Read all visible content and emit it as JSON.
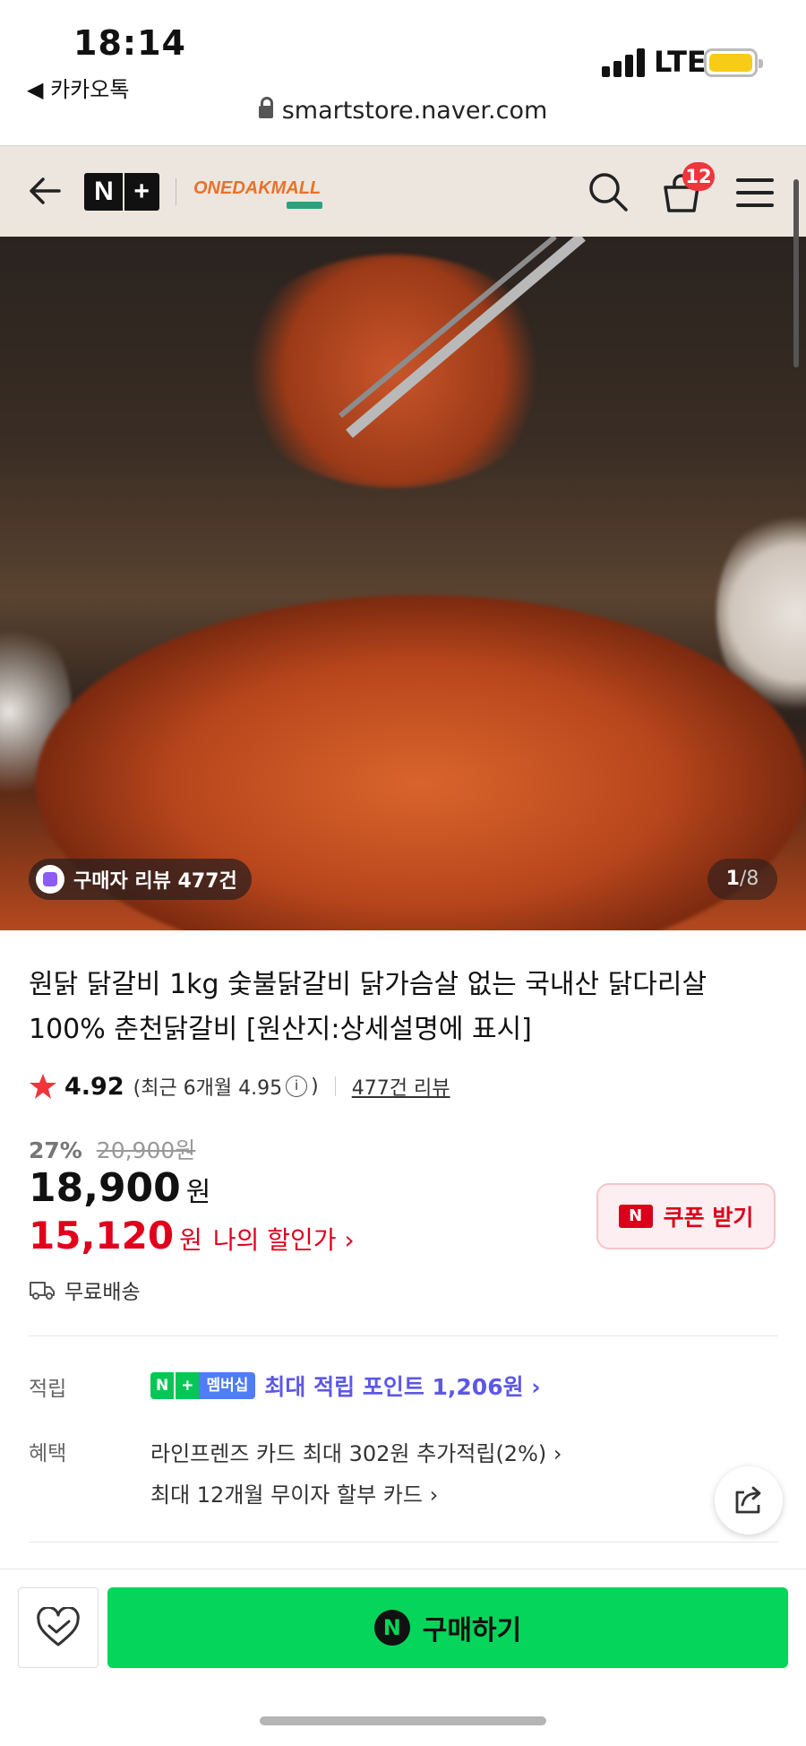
{
  "status": {
    "time": "18:14",
    "back_app": "◀ 카카오톡",
    "network": "LTE",
    "url": "smartstore.naver.com"
  },
  "header": {
    "nplus_n": "N",
    "nplus_plus": "+",
    "brand": "ONEDAKMALL",
    "cart_count": "12"
  },
  "hero": {
    "review_chip": "구매자 리뷰 477건",
    "page_current": "1",
    "page_total": "/8"
  },
  "product": {
    "title": "원닭 닭갈비 1kg 숯불닭갈비 닭가슴살 없는 국내산 닭다리살 100% 춘천닭갈비 [원산지:상세설명에 표시]",
    "rating": "4.92",
    "rating_recent_prefix": "(최근 6개월 4.95",
    "rating_recent_suffix": ")",
    "info_glyph": "i",
    "review_link": "477건 리뷰",
    "discount_pct": "27%",
    "original_price": "20,900원",
    "price": "18,900",
    "won": "원",
    "my_price": "15,120",
    "my_price_label": "나의 할인가 ›",
    "coupon_label": "쿠폰 받기",
    "coupon_icon_text": "N",
    "delivery": "무료배송"
  },
  "benefits": {
    "points_label": "적립",
    "badge_n": "N",
    "badge_plus": "+",
    "badge_member": "멤버십",
    "points_text": "최대 적립 포인트 1,206원 ›",
    "perks_label": "혜택",
    "perk_1": "라인프렌즈 카드 최대 302원 추가적립(2%) ›",
    "perk_2": "최대 12개월 무이자 할부 카드 ›"
  },
  "bottom": {
    "buy_icon": "N",
    "buy_label": "구매하기"
  },
  "colors": {
    "header_bg": "#ede6df",
    "price_red": "#e0001c",
    "buy_green": "#05d55a",
    "points_purple": "#5d57e8",
    "star": "#f0353b"
  }
}
